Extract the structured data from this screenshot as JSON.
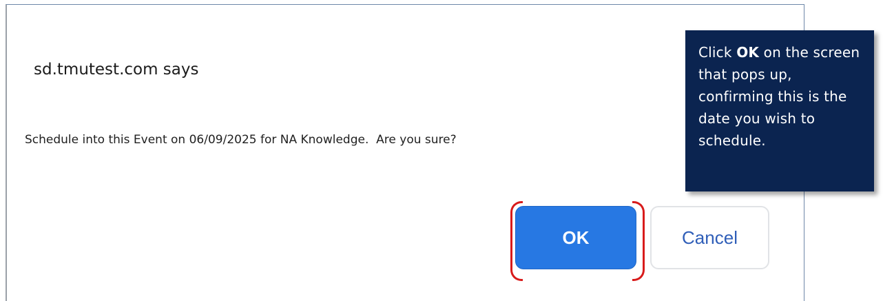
{
  "dialog": {
    "title": "sd.tmutest.com says",
    "message": "Schedule into this Event on 06/09/2025 for NA Knowledge.  Are you sure?",
    "ok_label": "OK",
    "cancel_label": "Cancel"
  },
  "callout": {
    "prefix": "Click ",
    "highlight": "OK",
    "suffix": " on the screen that pops up, confirming this is the date you wish to schedule."
  },
  "colors": {
    "ok_button": "#2778e3",
    "cancel_text": "#2f5eb8",
    "callout_bg": "#0b2450",
    "highlight_bracket": "#d81b1b"
  }
}
